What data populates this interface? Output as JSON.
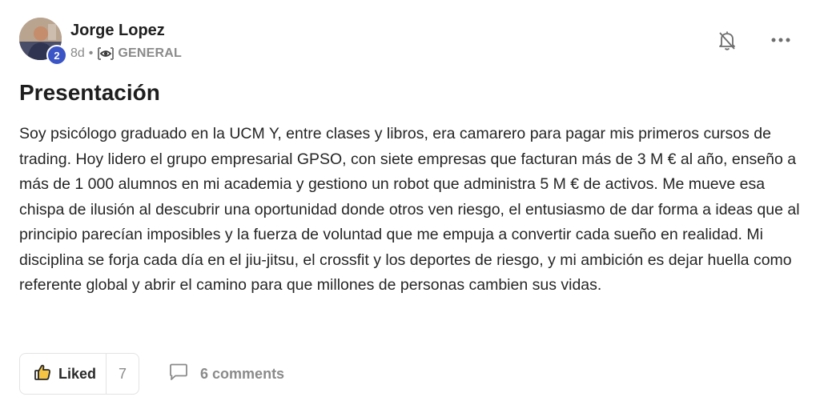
{
  "post": {
    "author": "Jorge Lopez",
    "level": "2",
    "time_ago": "8d",
    "separator": "•",
    "category": "GENERAL",
    "title": "Presentación",
    "body": "Soy psicólogo graduado en la UCM Y, entre clases y libros, era camarero para pagar mis primeros cursos de trading. Hoy lidero el grupo empresarial GPSO, con siete empresas que facturan más de 3 M € al año, enseño a más de 1 000 alumnos en mi academia y gestiono un robot que administra 5 M € de activos. Me mueve esa chispa de ilusión al descubrir una oportunidad donde otros ven riesgo, el entusiasmo de dar forma a ideas que al principio parecían imposibles y la fuerza de voluntad que me empuja a convertir cada sueño en realidad. Mi disciplina se forja cada día en el jiu-jitsu, el crossfit y los deportes de riesgo, y mi ambición es dejar huella como referente global y abrir el camino para que millones de personas cambien sus vidas."
  },
  "actions": {
    "like_label": "Liked",
    "like_count": "7",
    "comments_label": "6 comments"
  },
  "icons": {
    "category": "eye-bracket-icon",
    "notifications": "bell-off-icon",
    "more": "more-horizontal-icon",
    "like": "thumbs-up-icon",
    "comment": "comment-icon"
  },
  "colors": {
    "badge": "#3b54c6",
    "muted": "#8a8a8a"
  }
}
